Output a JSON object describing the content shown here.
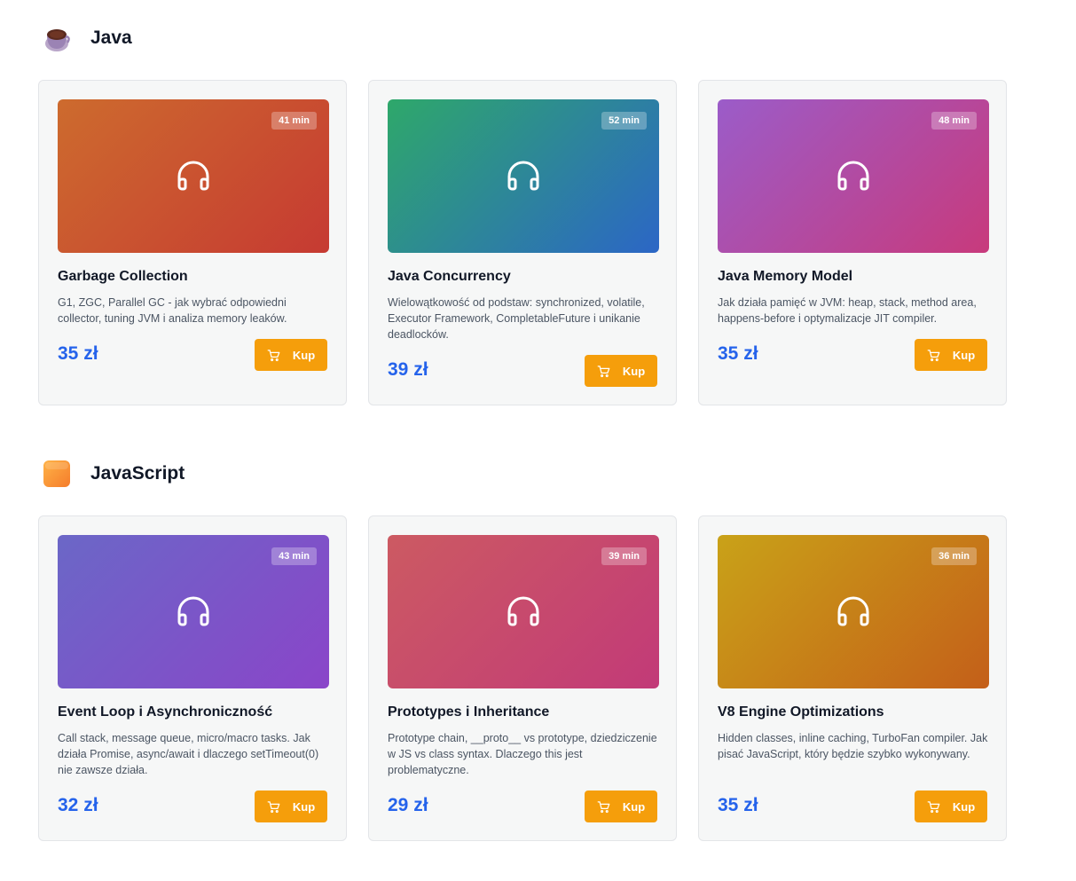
{
  "sections": [
    {
      "title": "Java",
      "icon": "coffee-cup-icon",
      "courses": [
        {
          "title": "Garbage Collection",
          "desc": "G1, ZGC, Parallel GC - jak wybrać odpowiedni collector, tuning JVM i analiza memory leaków.",
          "price": "35 zł",
          "duration": "41 min",
          "buy": "Kup",
          "gradient": [
            "#cd6b2e",
            "#c63a32"
          ]
        },
        {
          "title": "Java Concurrency",
          "desc": "Wielowątkowość od podstaw: synchronized, volatile, Executor Framework, CompletableFuture i unikanie deadlocków.",
          "price": "39 zł",
          "duration": "52 min",
          "buy": "Kup",
          "gradient": [
            "#2ea86a",
            "#2c66c6"
          ]
        },
        {
          "title": "Java Memory Model",
          "desc": "Jak działa pamięć w JVM: heap, stack, method area, happens-before i optymalizacje JIT compiler.",
          "price": "35 zł",
          "duration": "48 min",
          "buy": "Kup",
          "gradient": [
            "#9b5cc9",
            "#c83a7c"
          ]
        }
      ]
    },
    {
      "title": "JavaScript",
      "icon": "orange-square-icon",
      "courses": [
        {
          "title": "Event Loop i Asynchroniczność",
          "desc": "Call stack, message queue, micro/macro tasks. Jak działa Promise, async/await i dlaczego setTimeout(0) nie zawsze działa.",
          "price": "32 zł",
          "duration": "43 min",
          "buy": "Kup",
          "gradient": [
            "#6b67c7",
            "#8a45c9"
          ]
        },
        {
          "title": "Prototypes i Inheritance",
          "desc": "Prototype chain, __proto__ vs prototype, dziedziczenie w JS vs class syntax. Dlaczego this jest problematyczne.",
          "price": "29 zł",
          "duration": "39 min",
          "buy": "Kup",
          "gradient": [
            "#cc5a62",
            "#c23a78"
          ]
        },
        {
          "title": "V8 Engine Optimizations",
          "desc": "Hidden classes, inline caching, TurboFan compiler. Jak pisać JavaScript, który będzie szybko wykonywany.",
          "price": "35 zł",
          "duration": "36 min",
          "buy": "Kup",
          "gradient": [
            "#c9a218",
            "#c45f19"
          ]
        }
      ]
    }
  ]
}
